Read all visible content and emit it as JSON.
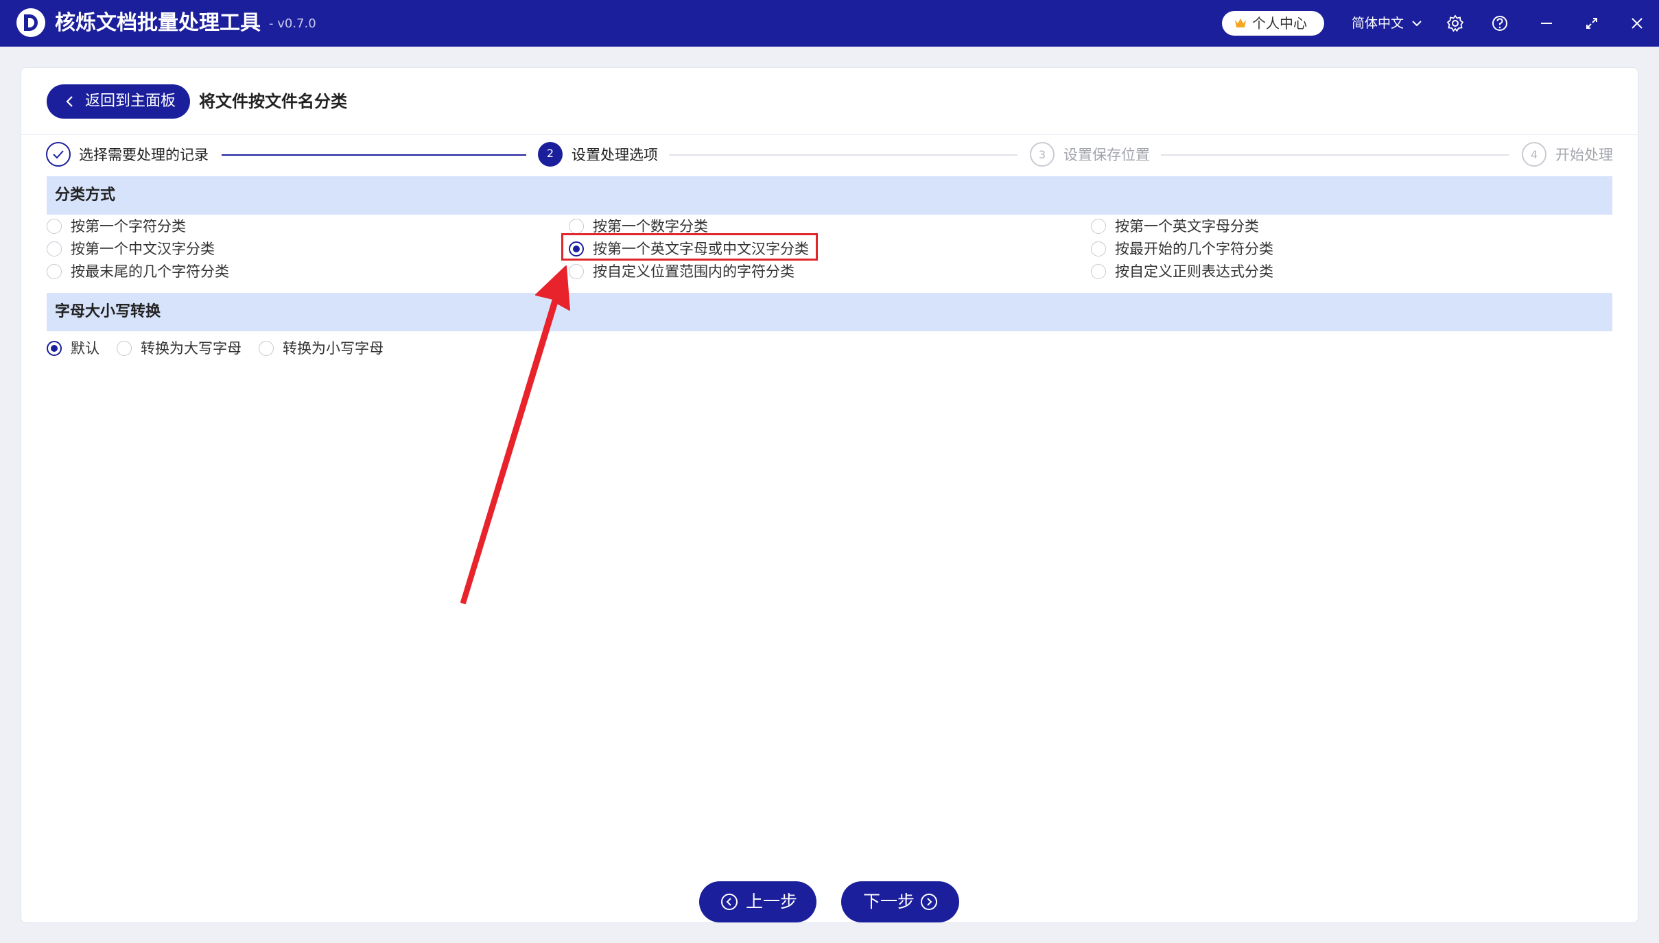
{
  "app": {
    "title": "核烁文档批量处理工具",
    "version": "- v0.7.0",
    "user_center_label": "个人中心",
    "language": "简体中文",
    "brand_color": "#1b1f9b"
  },
  "header": {
    "back_label": "返回到主面板",
    "page_title": "将文件按文件名分类"
  },
  "steps": [
    {
      "number": "1",
      "label": "选择需要处理的记录",
      "status": "done"
    },
    {
      "number": "2",
      "label": "设置处理选项",
      "status": "active"
    },
    {
      "number": "3",
      "label": "设置保存位置",
      "status": "todo"
    },
    {
      "number": "4",
      "label": "开始处理",
      "status": "todo"
    }
  ],
  "classify": {
    "title": "分类方式",
    "selected": "按第一个英文字母或中文汉字分类",
    "options": [
      "按第一个字符分类",
      "按第一个数字分类",
      "按第一个英文字母分类",
      "按第一个中文汉字分类",
      "按第一个英文字母或中文汉字分类",
      "按最开始的几个字符分类",
      "按最末尾的几个字符分类",
      "按自定义位置范围内的字符分类",
      "按自定义正则表达式分类"
    ]
  },
  "case_convert": {
    "title": "字母大小写转换",
    "selected": "默认",
    "options": [
      "默认",
      "转换为大写字母",
      "转换为小写字母"
    ]
  },
  "footer": {
    "prev_label": "上一步",
    "next_label": "下一步"
  },
  "annotation": {
    "highlight_color": "#e0262a"
  }
}
